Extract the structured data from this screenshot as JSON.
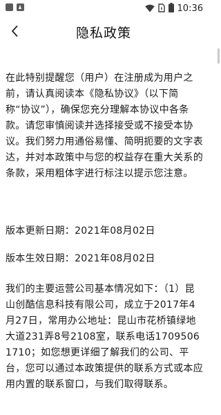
{
  "status_bar": {
    "time": "10:36",
    "left_icons": [
      "app-notification-icon",
      "a-notification-icon"
    ],
    "right_icons": [
      "wifi-icon",
      "sim-card-icon",
      "battery-icon"
    ]
  },
  "header": {
    "title": "隐私政策",
    "back_icon": "chevron-left-icon"
  },
  "content": {
    "intro": "在此特别提醒您（用户）在注册成为用户之前，请认真阅读本《隐私协议》（以下简称“协议”），确保您充分理解本协议中各条款。请您审慎阅读并选择接受或不接受本协议。我们努力用通俗易懂、简明扼要的文字表达，并对本政策中与您的权益存在重大关系的条款，采用粗体字进行标注以提示您注意。",
    "updated_date": "版本更新日期：2021年08月02日",
    "effective_date": "版本生效日期：2021年08月02日",
    "company_info": "我们的主要运营公司基本情况如下：（1）昆山创酷信息科技有限公司，成立于2017年4月27日，常用办公地址：昆山市花桥镇绿地大道231弄8号2108室，联系电话17095061710；如您想更详细了解我们的公司、平台，您可以通过本政策提供的联系方式或本应用内置的联系窗口，与我们取得联系。"
  }
}
